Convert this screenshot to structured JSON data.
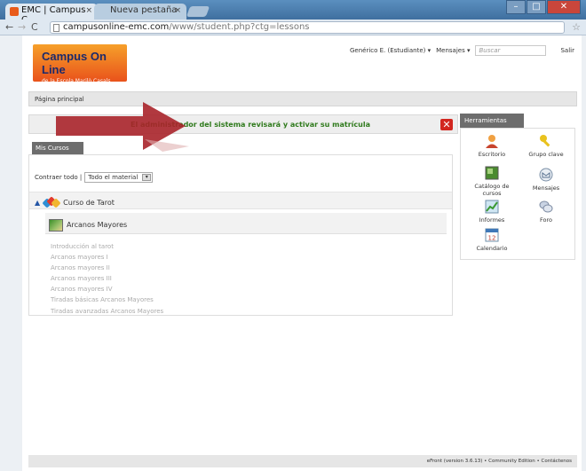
{
  "browser": {
    "tabs": [
      {
        "label": "EMC | Campus C",
        "active": true
      },
      {
        "label": "Nueva pestaña",
        "active": false
      }
    ],
    "url_host": "campusonline-emc.com",
    "url_path": "/www/student.php?ctg=lessons"
  },
  "logo": {
    "line1": "Campus On Line",
    "line2": "de la Escola Marilò Casals"
  },
  "userbar": {
    "user": "Genérico E. (Estudiante) ▾",
    "messages": "Mensajes ▾",
    "search_placeholder": "Buscar",
    "logout": "Salir"
  },
  "breadcrumb": "Página principal",
  "alert": {
    "text": "El administrador del sistema revisará y activar su matrícula"
  },
  "courses_panel": {
    "tab_label": "Mis Cursos",
    "collapse_label": "Contraer todo |",
    "filter_value": "Todo el material",
    "course_name": "Curso de Tarot",
    "lesson_name": "Arcanos Mayores",
    "lessons": [
      "Introducción al tarot",
      "Arcanos mayores I",
      "Arcanos mayores II",
      "Arcanos mayores III",
      "Arcanos mayores IV",
      "Tiradas básicas Arcanos Mayores",
      "Tiradas avanzadas Arcanos Mayores"
    ]
  },
  "tools": {
    "title": "Herramientas",
    "items": [
      {
        "label": "Escritorio",
        "icon": "user-icon"
      },
      {
        "label": "Grupo clave",
        "icon": "key-icon"
      },
      {
        "label": "Catálogo de cursos",
        "icon": "catalog-icon"
      },
      {
        "label": "Mensajes",
        "icon": "mail-icon"
      },
      {
        "label": "Informes",
        "icon": "chart-icon"
      },
      {
        "label": "Foro",
        "icon": "forum-icon"
      },
      {
        "label": "Calendario",
        "icon": "calendar-icon",
        "day": "12"
      }
    ]
  },
  "footer": "eFront (version 3.6.13) • Community Edition • Contáctenos",
  "colors": {
    "arrow": "#a8242a",
    "alert_text": "#2f7a1c",
    "close": "#d2261f",
    "logo": "#ea6a22"
  }
}
